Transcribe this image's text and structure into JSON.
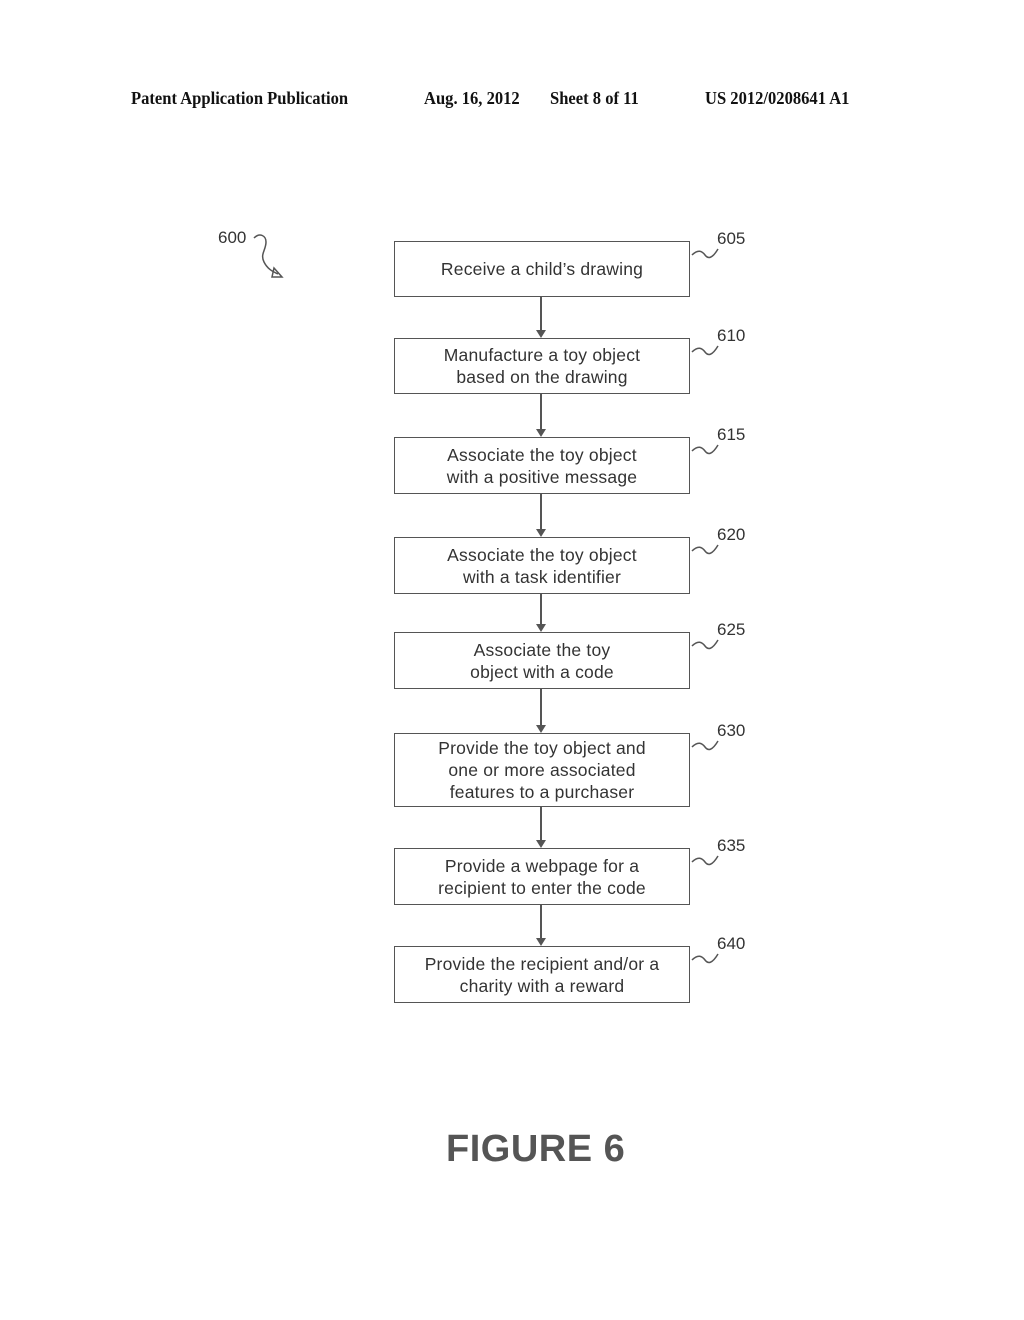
{
  "header": {
    "publication": "Patent Application Publication",
    "date": "Aug. 16, 2012",
    "sheet": "Sheet 8 of 11",
    "number": "US 2012/0208641 A1"
  },
  "diagram": {
    "ref": "600",
    "steps": [
      {
        "ref": "605",
        "lines": [
          "Receive a child’s drawing"
        ]
      },
      {
        "ref": "610",
        "lines": [
          "Manufacture a toy object",
          "based on the drawing"
        ]
      },
      {
        "ref": "615",
        "lines": [
          "Associate the toy object",
          "with a positive message"
        ]
      },
      {
        "ref": "620",
        "lines": [
          "Associate the toy object",
          "with a task identifier"
        ]
      },
      {
        "ref": "625",
        "lines": [
          "Associate the toy",
          "object with a code"
        ]
      },
      {
        "ref": "630",
        "lines": [
          "Provide the toy object and",
          "one or more associated",
          "features to a purchaser"
        ]
      },
      {
        "ref": "635",
        "lines": [
          "Provide a webpage for a",
          "recipient to enter the code"
        ]
      },
      {
        "ref": "640",
        "lines": [
          "Provide the recipient and/or a",
          "charity with a reward"
        ]
      }
    ]
  },
  "figure_label": "FIGURE 6"
}
